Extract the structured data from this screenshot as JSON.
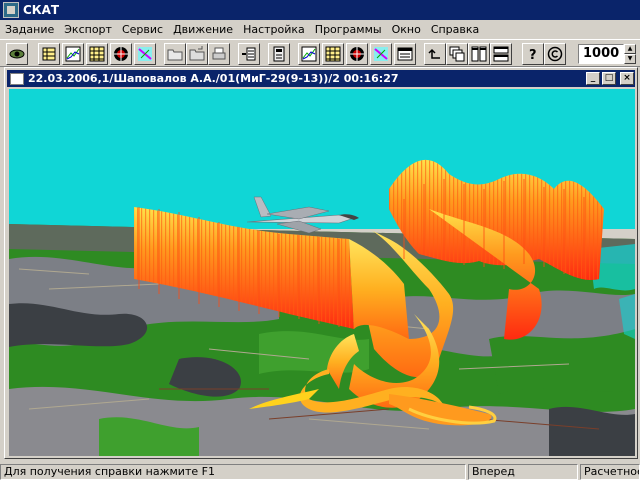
{
  "app": {
    "title": "СКАТ"
  },
  "menu": [
    "Задание",
    "Экспорт",
    "Сервис",
    "Движение",
    "Настройка",
    "Программы",
    "Окно",
    "Справка"
  ],
  "toolbar": {
    "buttons": [
      {
        "name": "eye-icon"
      },
      {
        "name": "table-view-icon"
      },
      {
        "name": "chart-icon"
      },
      {
        "name": "grid-icon"
      },
      {
        "name": "dial-icon"
      },
      {
        "name": "map-icon"
      },
      {
        "name": "open-folder-icon"
      },
      {
        "name": "save-icon"
      },
      {
        "name": "print-icon"
      },
      {
        "name": "export-icon"
      },
      {
        "name": "calculator-icon"
      },
      {
        "name": "chart-icon"
      },
      {
        "name": "grid-icon"
      },
      {
        "name": "dial-icon"
      },
      {
        "name": "map-icon"
      },
      {
        "name": "window-icon"
      },
      {
        "name": "undo-icon"
      },
      {
        "name": "cascade-icon"
      },
      {
        "name": "tile-vertical-icon"
      },
      {
        "name": "tile-horizontal-icon"
      },
      {
        "name": "help-icon"
      },
      {
        "name": "about-icon"
      }
    ],
    "zoom_value": "1000"
  },
  "document": {
    "title": "22.03.2006,1/Шаповалов А.А./01(МиГ-29(9-13))/2 00:16:27",
    "controls": {
      "minimize": "_",
      "maximize": "□",
      "close": "×"
    }
  },
  "status": {
    "hint": "Для получения справки нажмите F1",
    "direction": "Вперед",
    "mode": "Расчетное"
  },
  "colors": {
    "titlebar": "#0a246a",
    "sky": "#10d6d6",
    "terrain_green": "#2e8b22",
    "terrain_gray": "#7c7f86",
    "trail_red": "#ff3c14",
    "trail_yellow": "#ffd21c"
  }
}
